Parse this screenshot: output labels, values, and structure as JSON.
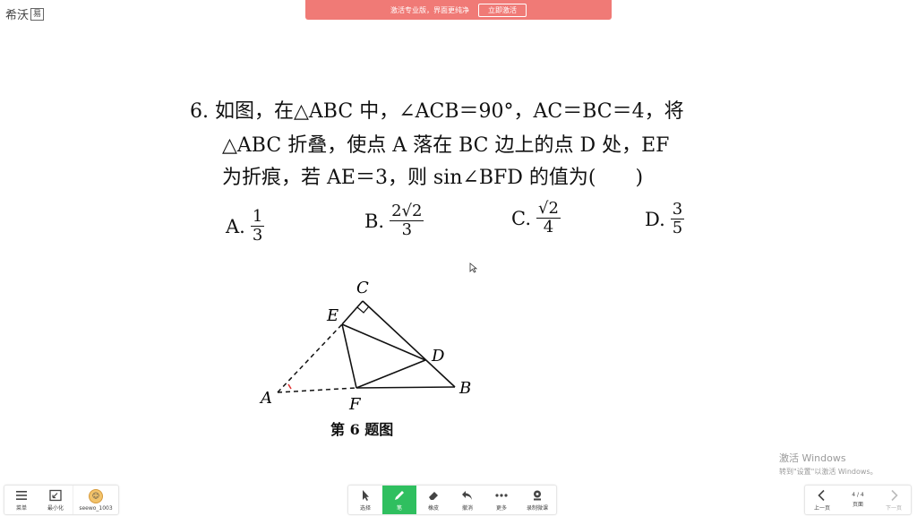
{
  "app": {
    "brand": "希沃",
    "brand_badge": "易"
  },
  "promo": {
    "text": "激活专业版，界面更纯净",
    "button": "立即激活",
    "color": "#f07a76"
  },
  "question": {
    "line1": "6. 如图，在△ABC 中，∠ACB＝90°，AC＝BC＝4，将",
    "line2": "△ABC 折叠，使点 A 落在 BC 边上的点 D 处，EF",
    "line3": "为折痕，若 AE＝3，则 sin∠BFD 的值为(　　)",
    "options": [
      {
        "label": "A.",
        "num": "1",
        "den": "3"
      },
      {
        "label": "B.",
        "num": "2√2",
        "den": "3"
      },
      {
        "label": "C.",
        "num": "√2",
        "den": "4"
      },
      {
        "label": "D.",
        "num": "3",
        "den": "5"
      }
    ],
    "caption": "第 6 题图"
  },
  "figure": {
    "C": "C",
    "E": "E",
    "D": "D",
    "A": "A",
    "F": "F",
    "B": "B"
  },
  "watermark": {
    "line1": "激活 Windows",
    "line2": "转到\"设置\"以激活 Windows。"
  },
  "toolbar_left": {
    "menu": "菜单",
    "minimize": "最小化",
    "user": "seewo_1003"
  },
  "toolbar_center": {
    "select": "选择",
    "pen": "笔",
    "eraser": "橡皮",
    "undo": "撤消",
    "more": "更多",
    "record": "录制微课"
  },
  "toolbar_right": {
    "prev": "上一页",
    "pages": "页面",
    "next": "下一页",
    "page_count": "4 / 4"
  },
  "colors": {
    "active_tool": "#2fbf5f"
  }
}
